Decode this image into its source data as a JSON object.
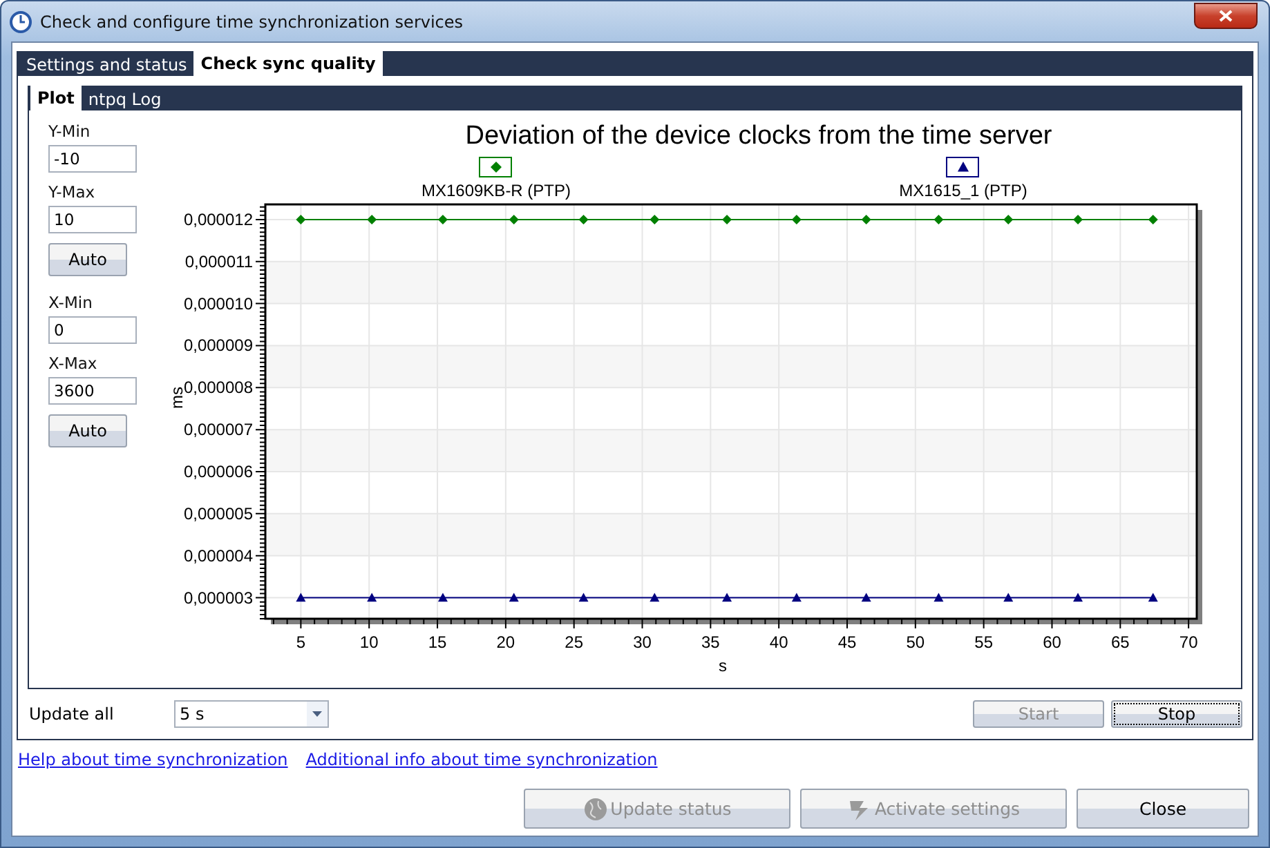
{
  "window": {
    "title": "Check and configure time synchronization services"
  },
  "tabs": [
    {
      "label": "Settings and status",
      "selected": false
    },
    {
      "label": "Check sync quality",
      "selected": true
    }
  ],
  "subtabs": [
    {
      "label": "Plot",
      "selected": true
    },
    {
      "label": "ntpq Log",
      "selected": false
    }
  ],
  "axis_controls": [
    {
      "kind": "field",
      "label": "Y-Min",
      "value": "-10"
    },
    {
      "kind": "field",
      "label": "Y-Max",
      "value": "10"
    },
    {
      "kind": "button",
      "label": "Auto"
    },
    {
      "kind": "field",
      "label": "X-Min",
      "value": "0"
    },
    {
      "kind": "field",
      "label": "X-Max",
      "value": "3600"
    },
    {
      "kind": "button",
      "label": "Auto"
    }
  ],
  "chart": {
    "chart_data": {
      "type": "line",
      "title": "Deviation of the device clocks from the time server",
      "xlabel": "s",
      "ylabel": "ms",
      "x": [
        5,
        10.2,
        15.4,
        20.6,
        25.7,
        30.9,
        36.2,
        41.3,
        46.4,
        51.7,
        56.8,
        61.9,
        67.4
      ],
      "series": [
        {
          "name": "MX1609KB-R (PTP)",
          "color": "#008000",
          "marker": "diamond",
          "values": [
            1.2e-05,
            1.2e-05,
            1.2e-05,
            1.2e-05,
            1.2e-05,
            1.2e-05,
            1.2e-05,
            1.2e-05,
            1.2e-05,
            1.2e-05,
            1.2e-05,
            1.2e-05,
            1.2e-05
          ]
        },
        {
          "name": "MX1615_1 (PTP)",
          "color": "#000080",
          "marker": "triangle",
          "values": [
            3e-06,
            3e-06,
            3e-06,
            3e-06,
            3e-06,
            3e-06,
            3e-06,
            3e-06,
            3e-06,
            3e-06,
            3e-06,
            3e-06,
            3e-06
          ]
        }
      ],
      "grid": true,
      "legend": true,
      "xlim": [
        2.4,
        70.6
      ],
      "ylim": [
        2.5e-06,
        1.236e-05
      ],
      "xticks": [
        5,
        10,
        15,
        20,
        25,
        30,
        35,
        40,
        45,
        50,
        55,
        60,
        65,
        70
      ],
      "yticks": [
        {
          "value": 3e-06,
          "label": "0,000003"
        },
        {
          "value": 4e-06,
          "label": "0,000004"
        },
        {
          "value": 5e-06,
          "label": "0,000005"
        },
        {
          "value": 6e-06,
          "label": "0,000006"
        },
        {
          "value": 7e-06,
          "label": "0,000007"
        },
        {
          "value": 8e-06,
          "label": "0,000008"
        },
        {
          "value": 9e-06,
          "label": "0,000009"
        },
        {
          "value": 1e-05,
          "label": "0,000010"
        },
        {
          "value": 1.1e-05,
          "label": "0,000011"
        },
        {
          "value": 1.2e-05,
          "label": "0,000012"
        }
      ]
    }
  },
  "update": {
    "label": "Update all",
    "value": "5 s"
  },
  "run_buttons": [
    {
      "label": "Start",
      "disabled": true
    },
    {
      "label": "Stop",
      "disabled": false
    }
  ],
  "links": [
    "Help about time synchronization",
    "Additional info about time synchronization"
  ],
  "buttons": [
    {
      "label": "Update status",
      "kind": "globe",
      "disabled": true
    },
    {
      "label": "Activate settings",
      "kind": "bolt",
      "disabled": true
    },
    {
      "label": "Close",
      "kind": "plain",
      "disabled": false
    }
  ]
}
